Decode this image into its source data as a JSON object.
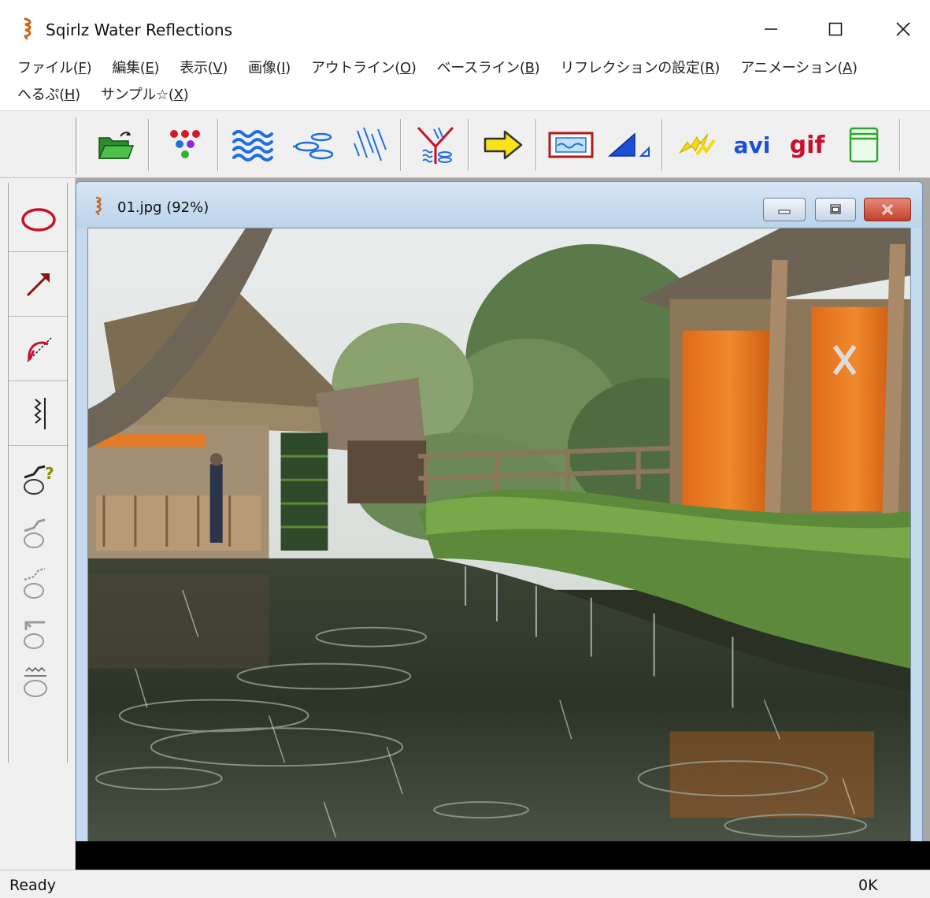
{
  "app": {
    "title": "Sqirlz Water Reflections"
  },
  "menu": {
    "items": [
      {
        "label": "ファイル(",
        "key": "F",
        "tail": ")"
      },
      {
        "label": "編集(",
        "key": "E",
        "tail": ")"
      },
      {
        "label": "表示(",
        "key": "V",
        "tail": ")"
      },
      {
        "label": "画像(",
        "key": "I",
        "tail": ")"
      },
      {
        "label": "アウトライン(",
        "key": "O",
        "tail": ")"
      },
      {
        "label": "ベースライン(",
        "key": "B",
        "tail": ")"
      },
      {
        "label": "リフレクションの設定(",
        "key": "R",
        "tail": ")"
      },
      {
        "label": "アニメーション(",
        "key": "A",
        "tail": ")"
      },
      {
        "label": "へるぷ(",
        "key": "H",
        "tail": ")"
      },
      {
        "label": "サンプル☆(",
        "key": "X",
        "tail": ")"
      }
    ]
  },
  "toolbar": {
    "avi_label": "avi",
    "gif_label": "gif"
  },
  "child_window": {
    "title": "01.jpg  (92%)"
  },
  "status": {
    "left": "Ready",
    "right": "0K"
  },
  "colors": {
    "accent_red": "#c8102e",
    "accent_blue": "#1a4fd6",
    "icon_green": "#3fa535",
    "icon_yellow": "#f7e31b"
  },
  "icons": [
    "open-folder-icon",
    "color-dots-icon",
    "water-waves-icon",
    "ripple-ellipses-icon",
    "rain-lines-icon",
    "reflection-split-icon",
    "arrow-right-icon",
    "preview-frame-icon",
    "triangle-icon",
    "lightning-icon",
    "avi-icon",
    "gif-icon",
    "panel-icon"
  ]
}
